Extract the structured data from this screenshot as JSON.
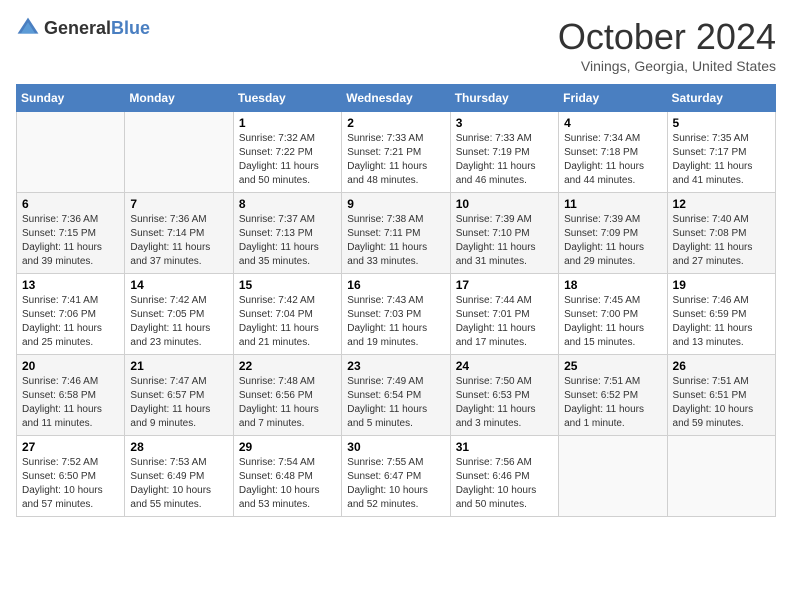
{
  "header": {
    "logo_general": "General",
    "logo_blue": "Blue",
    "month": "October 2024",
    "location": "Vinings, Georgia, United States"
  },
  "days_of_week": [
    "Sunday",
    "Monday",
    "Tuesday",
    "Wednesday",
    "Thursday",
    "Friday",
    "Saturday"
  ],
  "weeks": [
    [
      {
        "day": null,
        "info": null
      },
      {
        "day": null,
        "info": null
      },
      {
        "day": "1",
        "sunrise": "Sunrise: 7:32 AM",
        "sunset": "Sunset: 7:22 PM",
        "daylight": "Daylight: 11 hours and 50 minutes."
      },
      {
        "day": "2",
        "sunrise": "Sunrise: 7:33 AM",
        "sunset": "Sunset: 7:21 PM",
        "daylight": "Daylight: 11 hours and 48 minutes."
      },
      {
        "day": "3",
        "sunrise": "Sunrise: 7:33 AM",
        "sunset": "Sunset: 7:19 PM",
        "daylight": "Daylight: 11 hours and 46 minutes."
      },
      {
        "day": "4",
        "sunrise": "Sunrise: 7:34 AM",
        "sunset": "Sunset: 7:18 PM",
        "daylight": "Daylight: 11 hours and 44 minutes."
      },
      {
        "day": "5",
        "sunrise": "Sunrise: 7:35 AM",
        "sunset": "Sunset: 7:17 PM",
        "daylight": "Daylight: 11 hours and 41 minutes."
      }
    ],
    [
      {
        "day": "6",
        "sunrise": "Sunrise: 7:36 AM",
        "sunset": "Sunset: 7:15 PM",
        "daylight": "Daylight: 11 hours and 39 minutes."
      },
      {
        "day": "7",
        "sunrise": "Sunrise: 7:36 AM",
        "sunset": "Sunset: 7:14 PM",
        "daylight": "Daylight: 11 hours and 37 minutes."
      },
      {
        "day": "8",
        "sunrise": "Sunrise: 7:37 AM",
        "sunset": "Sunset: 7:13 PM",
        "daylight": "Daylight: 11 hours and 35 minutes."
      },
      {
        "day": "9",
        "sunrise": "Sunrise: 7:38 AM",
        "sunset": "Sunset: 7:11 PM",
        "daylight": "Daylight: 11 hours and 33 minutes."
      },
      {
        "day": "10",
        "sunrise": "Sunrise: 7:39 AM",
        "sunset": "Sunset: 7:10 PM",
        "daylight": "Daylight: 11 hours and 31 minutes."
      },
      {
        "day": "11",
        "sunrise": "Sunrise: 7:39 AM",
        "sunset": "Sunset: 7:09 PM",
        "daylight": "Daylight: 11 hours and 29 minutes."
      },
      {
        "day": "12",
        "sunrise": "Sunrise: 7:40 AM",
        "sunset": "Sunset: 7:08 PM",
        "daylight": "Daylight: 11 hours and 27 minutes."
      }
    ],
    [
      {
        "day": "13",
        "sunrise": "Sunrise: 7:41 AM",
        "sunset": "Sunset: 7:06 PM",
        "daylight": "Daylight: 11 hours and 25 minutes."
      },
      {
        "day": "14",
        "sunrise": "Sunrise: 7:42 AM",
        "sunset": "Sunset: 7:05 PM",
        "daylight": "Daylight: 11 hours and 23 minutes."
      },
      {
        "day": "15",
        "sunrise": "Sunrise: 7:42 AM",
        "sunset": "Sunset: 7:04 PM",
        "daylight": "Daylight: 11 hours and 21 minutes."
      },
      {
        "day": "16",
        "sunrise": "Sunrise: 7:43 AM",
        "sunset": "Sunset: 7:03 PM",
        "daylight": "Daylight: 11 hours and 19 minutes."
      },
      {
        "day": "17",
        "sunrise": "Sunrise: 7:44 AM",
        "sunset": "Sunset: 7:01 PM",
        "daylight": "Daylight: 11 hours and 17 minutes."
      },
      {
        "day": "18",
        "sunrise": "Sunrise: 7:45 AM",
        "sunset": "Sunset: 7:00 PM",
        "daylight": "Daylight: 11 hours and 15 minutes."
      },
      {
        "day": "19",
        "sunrise": "Sunrise: 7:46 AM",
        "sunset": "Sunset: 6:59 PM",
        "daylight": "Daylight: 11 hours and 13 minutes."
      }
    ],
    [
      {
        "day": "20",
        "sunrise": "Sunrise: 7:46 AM",
        "sunset": "Sunset: 6:58 PM",
        "daylight": "Daylight: 11 hours and 11 minutes."
      },
      {
        "day": "21",
        "sunrise": "Sunrise: 7:47 AM",
        "sunset": "Sunset: 6:57 PM",
        "daylight": "Daylight: 11 hours and 9 minutes."
      },
      {
        "day": "22",
        "sunrise": "Sunrise: 7:48 AM",
        "sunset": "Sunset: 6:56 PM",
        "daylight": "Daylight: 11 hours and 7 minutes."
      },
      {
        "day": "23",
        "sunrise": "Sunrise: 7:49 AM",
        "sunset": "Sunset: 6:54 PM",
        "daylight": "Daylight: 11 hours and 5 minutes."
      },
      {
        "day": "24",
        "sunrise": "Sunrise: 7:50 AM",
        "sunset": "Sunset: 6:53 PM",
        "daylight": "Daylight: 11 hours and 3 minutes."
      },
      {
        "day": "25",
        "sunrise": "Sunrise: 7:51 AM",
        "sunset": "Sunset: 6:52 PM",
        "daylight": "Daylight: 11 hours and 1 minute."
      },
      {
        "day": "26",
        "sunrise": "Sunrise: 7:51 AM",
        "sunset": "Sunset: 6:51 PM",
        "daylight": "Daylight: 10 hours and 59 minutes."
      }
    ],
    [
      {
        "day": "27",
        "sunrise": "Sunrise: 7:52 AM",
        "sunset": "Sunset: 6:50 PM",
        "daylight": "Daylight: 10 hours and 57 minutes."
      },
      {
        "day": "28",
        "sunrise": "Sunrise: 7:53 AM",
        "sunset": "Sunset: 6:49 PM",
        "daylight": "Daylight: 10 hours and 55 minutes."
      },
      {
        "day": "29",
        "sunrise": "Sunrise: 7:54 AM",
        "sunset": "Sunset: 6:48 PM",
        "daylight": "Daylight: 10 hours and 53 minutes."
      },
      {
        "day": "30",
        "sunrise": "Sunrise: 7:55 AM",
        "sunset": "Sunset: 6:47 PM",
        "daylight": "Daylight: 10 hours and 52 minutes."
      },
      {
        "day": "31",
        "sunrise": "Sunrise: 7:56 AM",
        "sunset": "Sunset: 6:46 PM",
        "daylight": "Daylight: 10 hours and 50 minutes."
      },
      {
        "day": null,
        "info": null
      },
      {
        "day": null,
        "info": null
      }
    ]
  ]
}
